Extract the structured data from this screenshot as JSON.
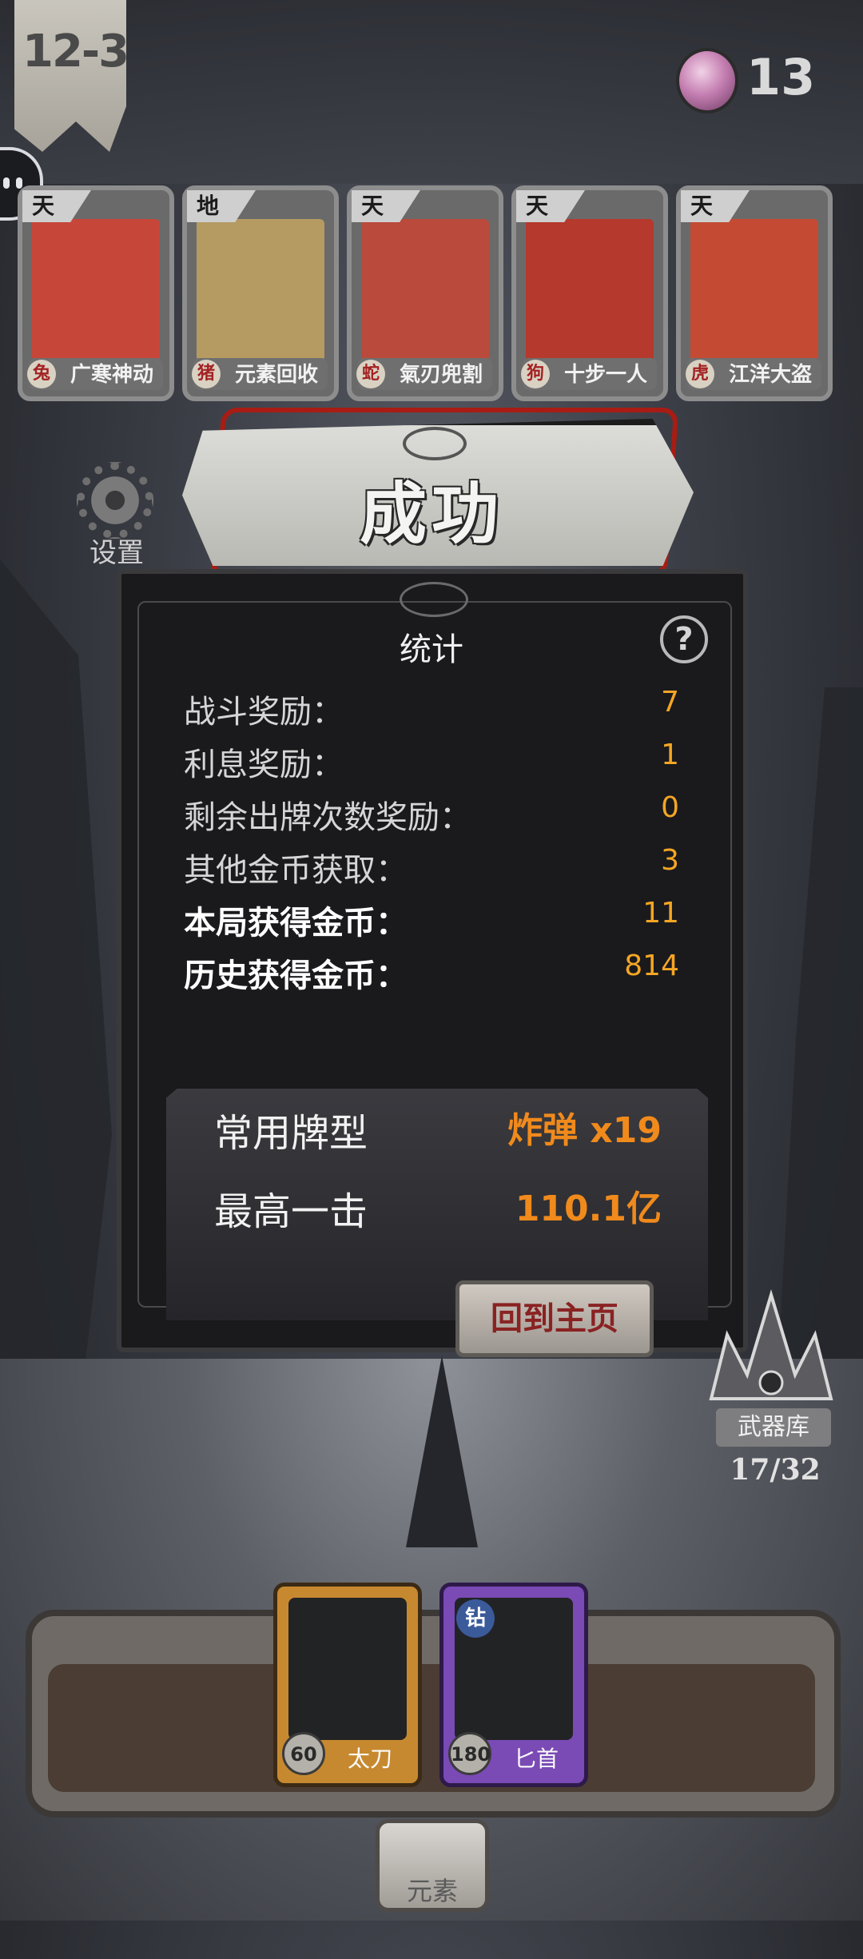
{
  "top_bar": {
    "level": "12-3",
    "gem_count": "13"
  },
  "character_cards": [
    {
      "rank": "天",
      "zodiac": "兔",
      "name": "广寒神动",
      "color": "#c7463a"
    },
    {
      "rank": "地",
      "zodiac": "猪",
      "name": "元素回收",
      "color": "#b59a62"
    },
    {
      "rank": "天",
      "zodiac": "蛇",
      "name": "氣刃兜割",
      "color": "#b94a3c"
    },
    {
      "rank": "天",
      "zodiac": "狗",
      "name": "十步一人",
      "color": "#b5392c"
    },
    {
      "rank": "天",
      "zodiac": "虎",
      "name": "江洋大盗",
      "color": "#c44a34"
    }
  ],
  "banner": {
    "title": "成功"
  },
  "settings": {
    "label": "设置"
  },
  "stats": {
    "title": "统计",
    "help": "?",
    "rows": [
      {
        "label": "战斗奖励：",
        "value": "7"
      },
      {
        "label": "利息奖励：",
        "value": "1"
      },
      {
        "label": "剩余出牌次数奖励：",
        "value": "0"
      },
      {
        "label": "其他金币获取：",
        "value": "3"
      },
      {
        "label": "本局获得金币：",
        "value": "11"
      },
      {
        "label": "历史获得金币：",
        "value": "814"
      }
    ],
    "highlights": [
      {
        "label": "常用牌型",
        "value": "炸弹 x19"
      },
      {
        "label": "最高一击",
        "value": "110.1亿"
      }
    ],
    "home_button": "回到主页"
  },
  "armory": {
    "label": "武器库",
    "count": "17/32"
  },
  "weapons": [
    {
      "name": "太刀",
      "cost": "60",
      "rank": "",
      "frame_color": "#c7892f"
    },
    {
      "name": "匕首",
      "cost": "180",
      "rank": "钻",
      "frame_color": "#7a4ab5"
    }
  ],
  "element_button": "元素",
  "colors": {
    "accent_orange": "#f5a623",
    "banner_red": "#a81c14"
  }
}
